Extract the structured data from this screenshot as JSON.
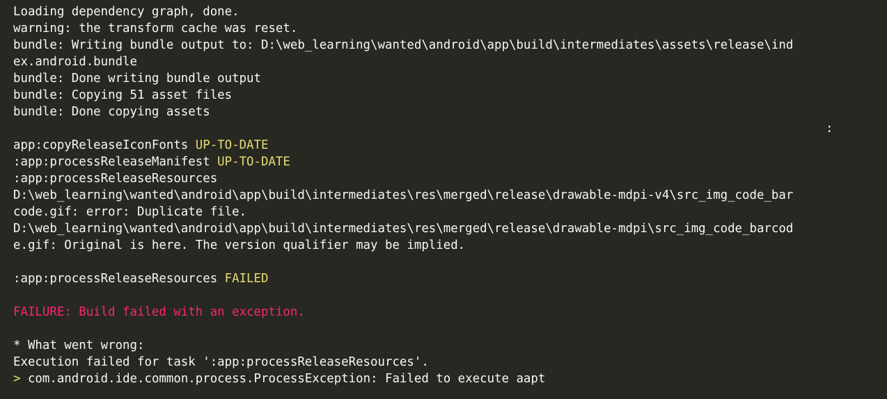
{
  "terminal": {
    "lines": {
      "l1": "Loading dependency graph, done.",
      "l2": "warning: the transform cache was reset.",
      "l3": "bundle: Writing bundle output to: D:\\web_learning\\wanted\\android\\app\\build\\intermediates\\assets\\release\\ind",
      "l4": "ex.android.bundle",
      "l5": "bundle: Done writing bundle output",
      "l6": "bundle: Copying 51 asset files",
      "l7": "bundle: Done copying assets",
      "l8": ":",
      "l9_task": "app:copyReleaseIconFonts ",
      "l9_status": "UP-TO-DATE",
      "l10_task": ":app:processReleaseManifest ",
      "l10_status": "UP-TO-DATE",
      "l11": ":app:processReleaseResources",
      "l12": "D:\\web_learning\\wanted\\android\\app\\build\\intermediates\\res\\merged\\release\\drawable-mdpi-v4\\src_img_code_bar",
      "l13": "code.gif: error: Duplicate file.",
      "l14": "D:\\web_learning\\wanted\\android\\app\\build\\intermediates\\res\\merged\\release\\drawable-mdpi\\src_img_code_barcod",
      "l15": "e.gif: Original is here. The version qualifier may be implied.",
      "l17_task": ":app:processReleaseResources ",
      "l17_status": "FAILED",
      "l19": "FAILURE: Build failed with an exception.",
      "l21": "* What went wrong:",
      "l22": "Execution failed for task ':app:processReleaseResources'.",
      "l23_prompt": ">",
      "l23": " com.android.ide.common.process.ProcessException: Failed to execute aapt"
    },
    "colors": {
      "background": "#272822",
      "foreground": "#f8f8f2",
      "status_yellow": "#e6db74",
      "failure_red": "#f92672"
    }
  }
}
